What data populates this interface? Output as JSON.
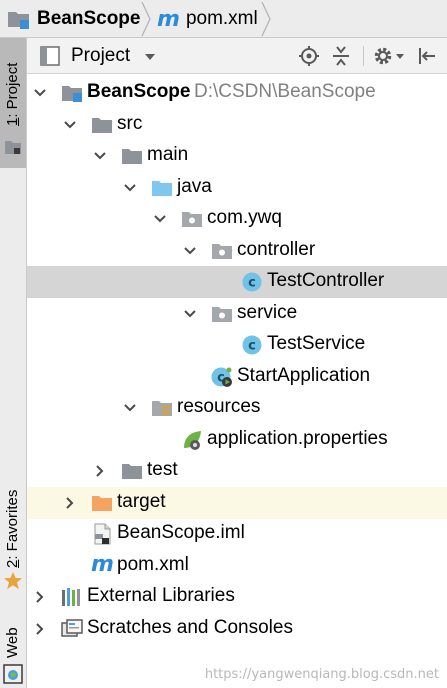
{
  "breadcrumb": {
    "project_name": "BeanScope",
    "file_name": "pom.xml"
  },
  "toolstrip": {
    "project_tab": {
      "number": "1",
      "label": ": Project"
    },
    "favorites_tab": {
      "number": "2",
      "label": ": Favorites"
    },
    "web_tab": {
      "label": "Web"
    }
  },
  "panel": {
    "title": "Project",
    "icons": [
      "locate-target-icon",
      "collapse-all-icon",
      "gear-icon",
      "hide-icon"
    ]
  },
  "tree": [
    {
      "label": "BeanScope",
      "path": "D:\\CSDN\\BeanScope",
      "icon": "module-folder-icon",
      "state": "expanded"
    },
    {
      "label": "src",
      "icon": "folder-icon",
      "state": "expanded"
    },
    {
      "label": "main",
      "icon": "folder-icon",
      "state": "expanded"
    },
    {
      "label": "java",
      "icon": "source-folder-icon",
      "state": "expanded"
    },
    {
      "label": "com.ywq",
      "icon": "package-icon",
      "state": "expanded"
    },
    {
      "label": "controller",
      "icon": "package-icon",
      "state": "expanded"
    },
    {
      "label": "TestController",
      "icon": "class-icon",
      "state": "selected"
    },
    {
      "label": "service",
      "icon": "package-icon",
      "state": "expanded"
    },
    {
      "label": "TestService",
      "icon": "class-icon"
    },
    {
      "label": "StartApplication",
      "icon": "spring-boot-class-icon"
    },
    {
      "label": "resources",
      "icon": "resources-folder-icon",
      "state": "expanded"
    },
    {
      "label": "application.properties",
      "icon": "spring-properties-icon"
    },
    {
      "label": "test",
      "icon": "folder-icon",
      "state": "collapsed"
    },
    {
      "label": "target",
      "icon": "excluded-folder-icon",
      "state": "collapsed"
    },
    {
      "label": "BeanScope.iml",
      "icon": "iml-file-icon"
    },
    {
      "label": "pom.xml",
      "icon": "maven-icon"
    },
    {
      "label": "External Libraries",
      "icon": "libraries-icon",
      "state": "collapsed"
    },
    {
      "label": "Scratches and Consoles",
      "icon": "scratches-icon",
      "state": "collapsed"
    }
  ],
  "colors": {
    "class_icon": "#6fc3e6",
    "spring_green": "#6db33f",
    "excluded_folder": "#f4a460",
    "source_folder": "#7fc7ee",
    "selection": "#d5d5d5"
  },
  "watermark": "https://yangwenqiang.blog.csdn.net"
}
